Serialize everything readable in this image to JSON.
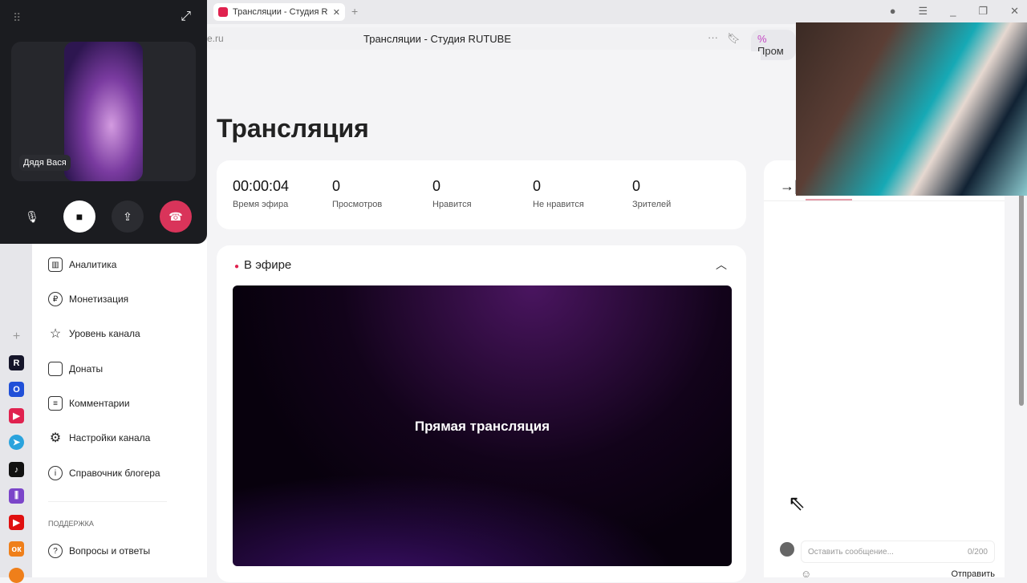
{
  "browser": {
    "tab_title": "Трансляции - Студия R",
    "address_host": "e.ru",
    "page_title": "Трансляции - Студия RUTUBE",
    "promo": "Пром",
    "promo_icon": "%"
  },
  "call": {
    "participant": "Дядя Вася"
  },
  "sidebar": {
    "items": [
      {
        "label": "Аналитика",
        "icon": "chart-icon"
      },
      {
        "label": "Монетизация",
        "icon": "ruble-icon"
      },
      {
        "label": "Уровень канала",
        "icon": "star-icon"
      },
      {
        "label": "Донаты",
        "icon": "wallet-icon"
      },
      {
        "label": "Комментарии",
        "icon": "comment-icon"
      },
      {
        "label": "Настройки канала",
        "icon": "gear-icon"
      },
      {
        "label": "Справочник блогера",
        "icon": "info-icon"
      }
    ],
    "support_heading": "ПОДДЕРЖКА",
    "support_items": [
      {
        "label": "Вопросы и ответы",
        "icon": "help-icon"
      }
    ]
  },
  "main": {
    "title": "Трансляция",
    "stats": [
      {
        "value": "00:00:04",
        "label": "Время эфира"
      },
      {
        "value": "0",
        "label": "Просмотров"
      },
      {
        "value": "0",
        "label": "Нравится"
      },
      {
        "value": "0",
        "label": "Не нравится"
      },
      {
        "value": "0",
        "label": "Зрителей"
      }
    ],
    "live_heading": "В эфире",
    "player_text": "Прямая трансляция"
  },
  "chat": {
    "placeholder": "Оставить сообщение...",
    "counter": "0/200",
    "send": "Отправить"
  },
  "colors": {
    "accent": "#e0224f"
  }
}
